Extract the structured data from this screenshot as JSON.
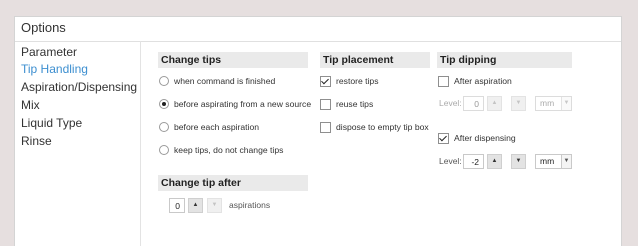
{
  "window": {
    "title": "Options"
  },
  "nav": {
    "items": [
      {
        "label": "Parameter"
      },
      {
        "label": "Tip Handling"
      },
      {
        "label": "Aspiration/Dispensing"
      },
      {
        "label": "Mix"
      },
      {
        "label": "Liquid Type"
      },
      {
        "label": "Rinse"
      }
    ],
    "active": "Tip Handling"
  },
  "change_tips": {
    "header": "Change tips",
    "options": [
      {
        "label": "when command is finished",
        "selected": false
      },
      {
        "label": "before aspirating from a new source",
        "selected": true
      },
      {
        "label": "before each aspiration",
        "selected": false
      },
      {
        "label": "keep tips, do not change tips",
        "selected": false
      }
    ]
  },
  "change_tip_after": {
    "header": "Change tip after",
    "value": "0",
    "unit": "aspirations",
    "up_icon": "triangle-up",
    "down_icon": "triangle-down"
  },
  "tip_placement": {
    "header": "Tip placement",
    "options": [
      {
        "label": "restore tips",
        "checked": true
      },
      {
        "label": "reuse tips",
        "checked": false
      },
      {
        "label": "dispose to empty tip box",
        "checked": false
      }
    ]
  },
  "tip_dipping": {
    "header": "Tip dipping",
    "after_aspiration": {
      "label": "After aspiration",
      "checked": false,
      "level_label": "Level:",
      "value": "0",
      "unit": "mm"
    },
    "after_dispensing": {
      "label": "After dispensing",
      "checked": true,
      "level_label": "Level:",
      "value": "-2",
      "unit": "mm"
    }
  },
  "colors": {
    "accent": "#3d8fd0",
    "section_bg": "#eaeaea",
    "page_bg": "#e6dfdf"
  }
}
